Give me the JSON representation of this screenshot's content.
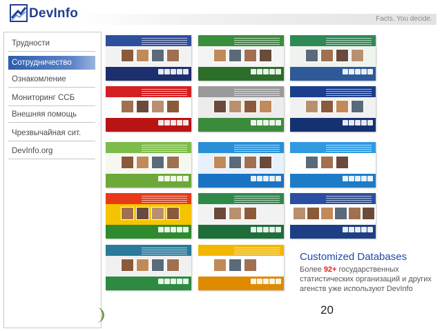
{
  "brand": {
    "name": "DevInfo",
    "tagline": "Facts. You decide."
  },
  "sidebar": {
    "items": [
      {
        "label": "Трудности",
        "active": false
      },
      {
        "label": "Сотрудничество",
        "active": true
      },
      {
        "label": "Ознакомление",
        "active": false
      },
      {
        "label": "Мониторинг ССБ",
        "active": false
      },
      {
        "label": "Внешняя помощь",
        "active": false
      },
      {
        "label": "Чрезвычайная сит.",
        "active": false
      },
      {
        "label": "DevInfo.org",
        "active": false
      }
    ]
  },
  "thumbnails": [
    {
      "name": "thumb-nepal",
      "top": "#2d4f9e",
      "mid": "#f2f2f2",
      "bottom": "#1d2f6e",
      "photos": 4
    },
    {
      "name": "thumb-devinfo-tanzania",
      "top": "#3a8d3a",
      "mid": "#f4f4f4",
      "bottom": "#2a6e2a",
      "photos": 4
    },
    {
      "name": "thumb-urban-info",
      "top": "#2e8a55",
      "mid": "#eef3ee",
      "bottom": "#2f5a9a",
      "photos": 4
    },
    {
      "name": "thumb-red-info",
      "top": "#d42020",
      "mid": "#ffffff",
      "bottom": "#b81414",
      "photos": 4
    },
    {
      "name": "thumb-grey-green",
      "top": "#9a9a9a",
      "mid": "#ececec",
      "bottom": "#3c8a3c",
      "photos": 4
    },
    {
      "name": "thumb-wbg-info",
      "top": "#1b3f8c",
      "mid": "#f1f1f1",
      "bottom": "#143172",
      "photos": 4
    },
    {
      "name": "thumb-green-wave",
      "top": "#7dbb4a",
      "mid": "#f6f8f0",
      "bottom": "#6ca83a",
      "photos": 4
    },
    {
      "name": "thumb-unicef-devinfo",
      "top": "#2a8fd6",
      "mid": "#e6f1fb",
      "bottom": "#1a73c2",
      "photos": 4
    },
    {
      "name": "thumb-unicef-blue",
      "top": "#2f9ae0",
      "mid": "#ffffff",
      "bottom": "#1c7cc8",
      "photos": 3
    },
    {
      "name": "thumb-ethiopia",
      "top": "#e83a18",
      "mid": "#f5c400",
      "bottom": "#2f8a2f",
      "photos": 4
    },
    {
      "name": "thumb-info-green",
      "top": "#2f8a4a",
      "mid": "#f2f2f2",
      "bottom": "#1f6e3a",
      "photos": 3
    },
    {
      "name": "thumb-mdg-info",
      "top": "#2a4fa0",
      "mid": "#ffffff",
      "bottom": "#1e3f86",
      "photos": 6
    },
    {
      "name": "thumb-teal-info",
      "top": "#2a7a9a",
      "mid": "#f0f0f0",
      "bottom": "#2e8a40",
      "photos": 4
    },
    {
      "name": "thumb-orange-info",
      "top": "#f2b800",
      "mid": "#ffffff",
      "bottom": "#e08a00",
      "photos": 3
    }
  ],
  "caption": {
    "title": "Customized Databases",
    "prefix": "Более ",
    "count": "92+",
    "body": " государственных статистических организаций и других агенств уже используют DevInfo"
  },
  "page_number": "20",
  "colors": {
    "accent": "#2f5cae",
    "highlight": "#e0231c",
    "caption_title": "#1f47a8"
  }
}
